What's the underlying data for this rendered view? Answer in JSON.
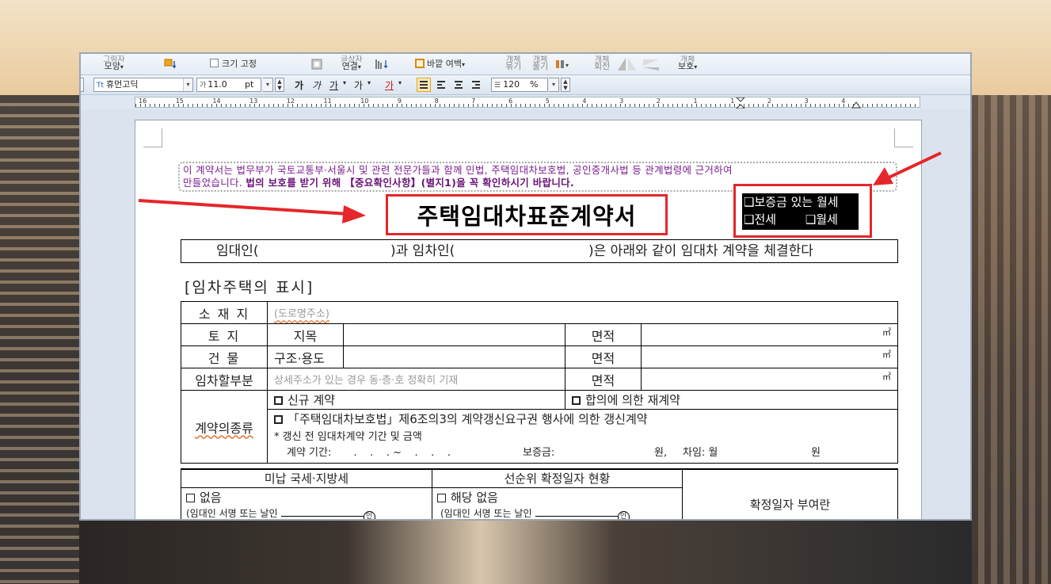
{
  "toolbar": {
    "shape_label": "모양",
    "shape_label_top": "그림자",
    "fixed_size_label": "크기 고정",
    "link_label": "연결",
    "link_label_top": "글상자",
    "margin_label": "바깥 여백",
    "group_label": "묶기",
    "ungroup_label": "풀기",
    "group_top": "개체",
    "rotate_label": "회전",
    "rotate_top": "개체",
    "protect_label": "보호",
    "protect_top": "개체"
  },
  "format_bar": {
    "font_name": "휴먼고딕",
    "font_size": "11.0",
    "font_unit": "pt",
    "bold": "가",
    "italic": "가",
    "underline": "가",
    "strike": "가",
    "color": "가",
    "line_spacing": "120",
    "line_spacing_unit": "%"
  },
  "ruler": {
    "numbers": [
      "16",
      "15",
      "14",
      "13",
      "12",
      "11",
      "10",
      "9",
      "8",
      "7",
      "6",
      "5",
      "4",
      "3",
      "2",
      "1",
      "1",
      "2",
      "3",
      "4"
    ]
  },
  "document": {
    "notice_line1": "이 계약서는 법무부가 국토교통부·서울시 및 관련 전문가들과 함께 민법, 주택임대차보호법, 공인중개사법 등 관계법령에 근거하여",
    "notice_line2_a": "만들었습니다. ",
    "notice_line2_b": "법의 보호를 받기 위해 【중요확인사항】(별지1)을 꼭 확인하시기 바랍니다.",
    "title": "주택임대차표준계약서",
    "type_option1": "❑보증금 있는 월세",
    "type_option2": "❑전세",
    "type_option3": "❑월세",
    "parties_a": "임대인(",
    "parties_b": ")과 임차인(",
    "parties_c": ")은 아래와 같이 임대차 계약을 체결한다",
    "section_title": "[임차주택의 표시]",
    "rows": {
      "location_label": "소 재 지",
      "location_placeholder": "(도로명주소)",
      "land_label": "토    지",
      "land_sub": "지목",
      "building_label": "건    물",
      "building_sub": "구조·용도",
      "rent_part_label": "임차할부분",
      "rent_part_placeholder": "상세주소가 있는 경우 동·층·호 정확히 기재",
      "area_label": "면적",
      "area_unit": "㎡",
      "contract_type_label": "계약의종류",
      "new_contract": "신규 계약",
      "renewal_by_agreement": "합의에 의한 재계약",
      "renewal_right": "「주택임대차보호법」제6조의3의 계약갱신요구권 행사에 의한 갱신계약",
      "prev_contract_note": "* 갱신 전 임대차계약 기간 및 금액",
      "period_label": "계약 기간:",
      "period_value": ".    .    . ~    .    .    .",
      "deposit_label": "보증금:",
      "won1": "원,",
      "monthly_label": "차임: 월",
      "won2": "원"
    },
    "tax": {
      "col1": "미납 국세·지방세",
      "col2": "선순위 확정일자 현황",
      "col3": "확정일자 부여란",
      "none1": "없음",
      "none2": "해당 없음",
      "sign1": "(임대인 서명 또는 날인",
      "sign2": "(임대인 서명 또는 날인",
      "seal": "인"
    }
  },
  "colors": {
    "notice_purple": "#7b1f8f",
    "highlight_red": "#e5262a"
  }
}
